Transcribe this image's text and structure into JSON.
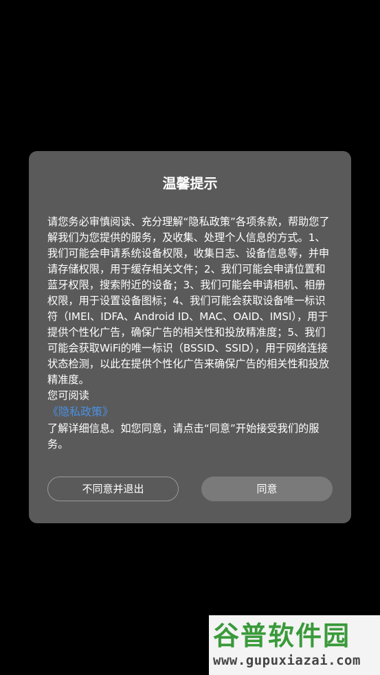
{
  "dialog": {
    "title": "温馨提示",
    "intro": "请您务必审慎阅读、充分理解“隐私政策”各项条款，帮助您了解我们为您提供的服务，及收集、处理个人信息的方式。1、我们可能会申请系统设备权限，收集日志、设备信息等，并申请存储权限，用于缓存相关文件；2、我们可能会申请位置和蓝牙权限，搜索附近的设备；3、我们可能会申请相机、相册权限，用于设置设备图标；4、我们可能会获取设备唯一标识符（IMEI、IDFA、Android ID、MAC、OAID、IMSI），用于提供个性化广告，确保广告的相关性和投放精准度；5、我们可能会获取WiFi的唯一标识（BSSID、SSID），用于网络连接状态检测，以此在提供个性化广告来确保广告的相关性和投放精准度。",
    "read_prompt": "您可阅读",
    "policy_link": "《隐私政策》",
    "outro": "了解详细信息。如您同意，请点击“同意”开始接受我们的服务。",
    "decline_label": "不同意并退出",
    "accept_label": "同意"
  },
  "watermark": {
    "logo_text": "谷普软件园",
    "url_text": "www.gupuxiazai.com"
  },
  "colors": {
    "background": "#000000",
    "dialog_bg": "#5a5a5a",
    "link": "#4a90e2",
    "accept_bg": "#7a7a7a",
    "watermark_green": "#3a9a3a"
  }
}
